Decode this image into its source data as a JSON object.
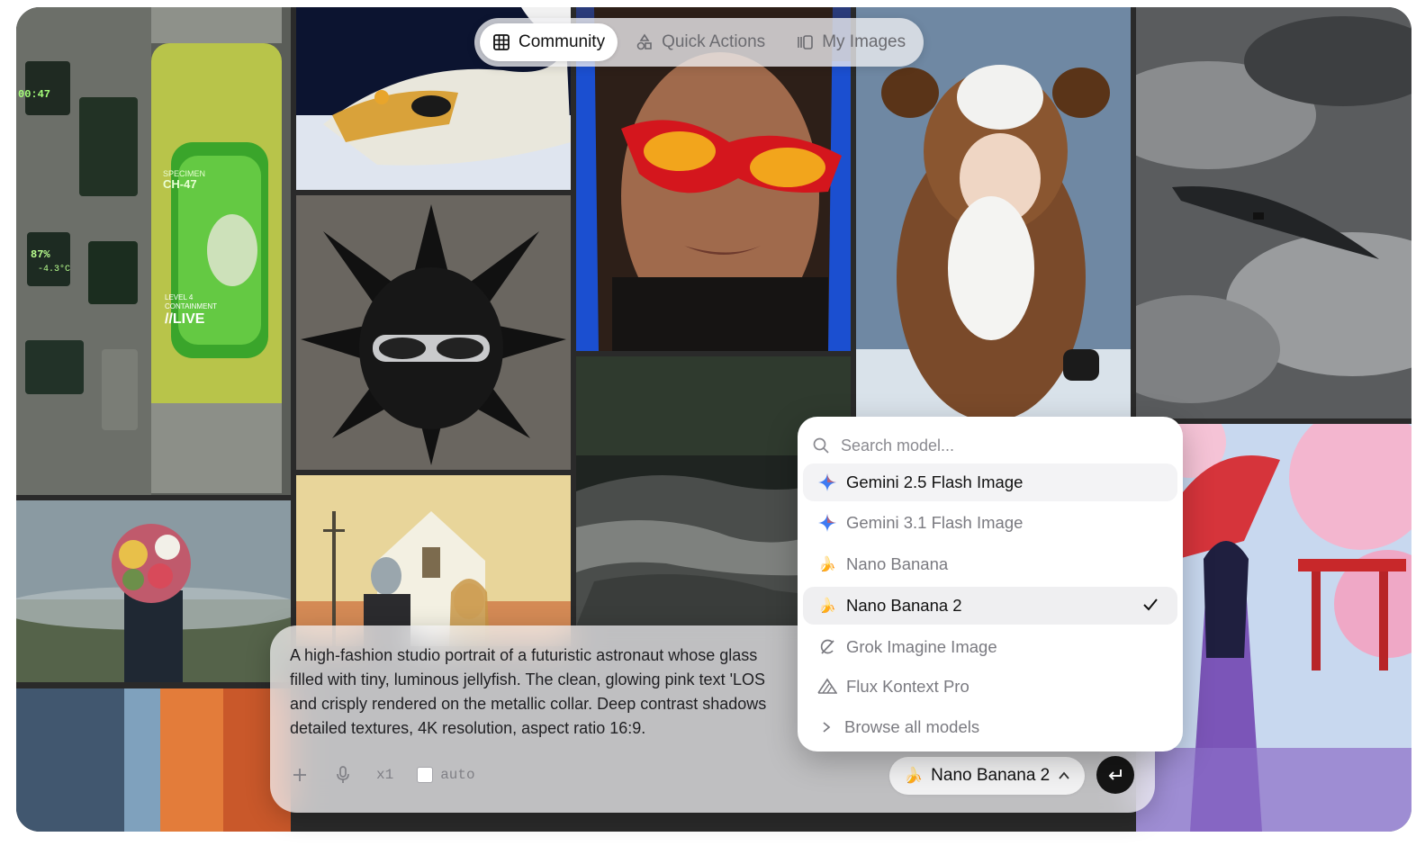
{
  "nav": {
    "tabs": [
      {
        "label": "Community",
        "icon": "grid-icon",
        "active": true
      },
      {
        "label": "Quick Actions",
        "icon": "shapes-icon",
        "active": false
      },
      {
        "label": "My Images",
        "icon": "gallery-icon",
        "active": false
      }
    ]
  },
  "gallery": {
    "images": [
      {
        "name": "specimen-lab",
        "overlay": [
          "00:47",
          "SPECIMEN",
          "CH-47",
          "87%",
          "-4.3°C",
          "LEVEL 4",
          "CONTAINMENT",
          "//LIVE"
        ]
      },
      {
        "name": "dragon-fish"
      },
      {
        "name": "woman-red-sunglasses"
      },
      {
        "name": "baby-cow-costume"
      },
      {
        "name": "airship-clouds"
      },
      {
        "name": "spiky-cat-sunglasses"
      },
      {
        "name": "flower-head-man"
      },
      {
        "name": "robot-american-gothic"
      },
      {
        "name": "river-rapids"
      },
      {
        "name": "anime-umbrella-girl"
      },
      {
        "name": "blurred-orange"
      }
    ]
  },
  "prompt": {
    "lines": [
      "A high-fashion studio portrait of a futuristic astronaut whose glass",
      "filled with tiny, luminous jellyfish. The clean, glowing pink text 'LOS",
      "and crisply rendered on the metallic collar. Deep contrast shadows",
      "detailed textures, 4K resolution, aspect ratio 16:9."
    ],
    "count": "x1",
    "auto_label": "auto",
    "auto_checked": false,
    "model": "Nano Banana 2"
  },
  "model_menu": {
    "search_placeholder": "Search model...",
    "options": [
      {
        "label": "Gemini 2.5 Flash Image",
        "icon": "gemini-sparkle-icon",
        "state": "hover"
      },
      {
        "label": "Gemini 3.1 Flash Image",
        "icon": "gemini-sparkle-icon",
        "state": ""
      },
      {
        "label": "Nano Banana",
        "icon": "banana-icon",
        "state": ""
      },
      {
        "label": "Nano Banana 2",
        "icon": "banana-icon",
        "state": "selected"
      },
      {
        "label": "Grok Imagine Image",
        "icon": "grok-icon",
        "state": ""
      },
      {
        "label": "Flux Kontext Pro",
        "icon": "flux-icon",
        "state": ""
      }
    ],
    "browse_label": "Browse all models"
  },
  "colors": {
    "accent_dark": "#151515",
    "lab_green": "#9bd12a",
    "sunglasses_red": "#c8161d"
  }
}
